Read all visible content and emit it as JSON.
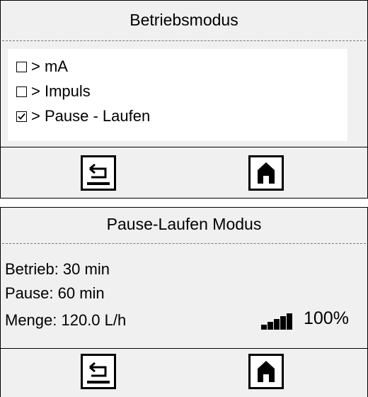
{
  "mode_screen": {
    "title": "Betriebsmodus",
    "options": [
      {
        "label": "> mA",
        "checked": false
      },
      {
        "label": "> Impuls",
        "checked": false
      },
      {
        "label": "> Pause - Laufen",
        "checked": true
      }
    ]
  },
  "pause_screen": {
    "title": "Pause-Laufen Modus",
    "betrieb": "Betrieb: 30 min",
    "pause": "Pause: 60 min",
    "menge": "Menge: 120.0 L/h",
    "level_percent": "100%",
    "level_fraction": 1.0
  },
  "icons": {
    "back": "back-arrow-icon",
    "home": "home-icon"
  }
}
